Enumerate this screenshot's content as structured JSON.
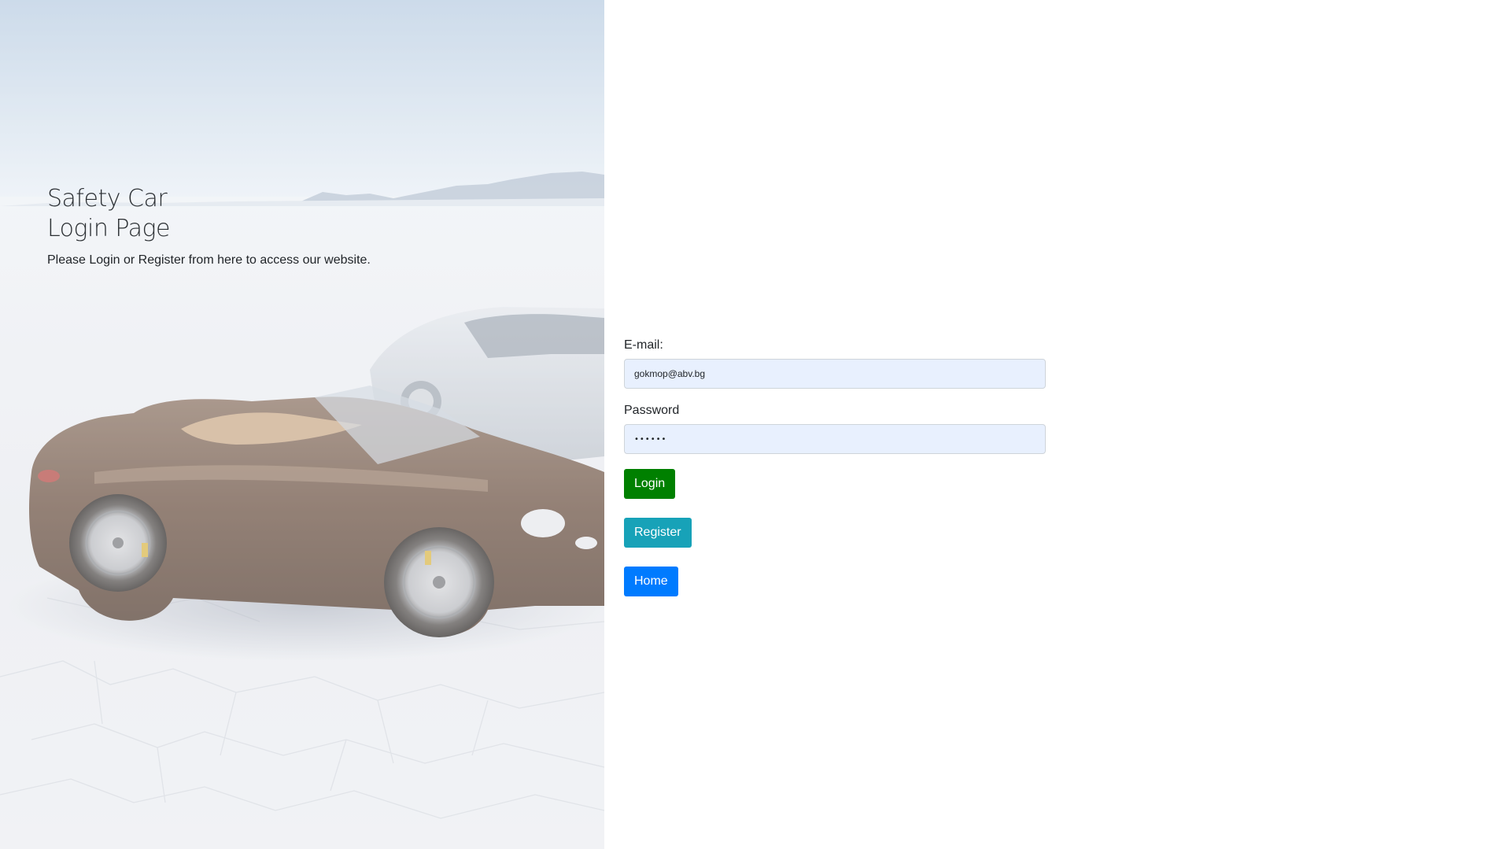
{
  "hero": {
    "title_line1": "Safety Car",
    "title_line2": "Login Page",
    "subtitle": "Please Login or Register from here to access our website."
  },
  "form": {
    "email_label": "E-mail:",
    "email_value": "gokmop@abv.bg",
    "password_label": "Password",
    "password_value": "••••••"
  },
  "buttons": {
    "login": "Login",
    "register": "Register",
    "home": "Home"
  },
  "colors": {
    "login": "#008000",
    "register": "#17a2b8",
    "home": "#007bff",
    "input_autofill_bg": "#e8f0fe"
  }
}
